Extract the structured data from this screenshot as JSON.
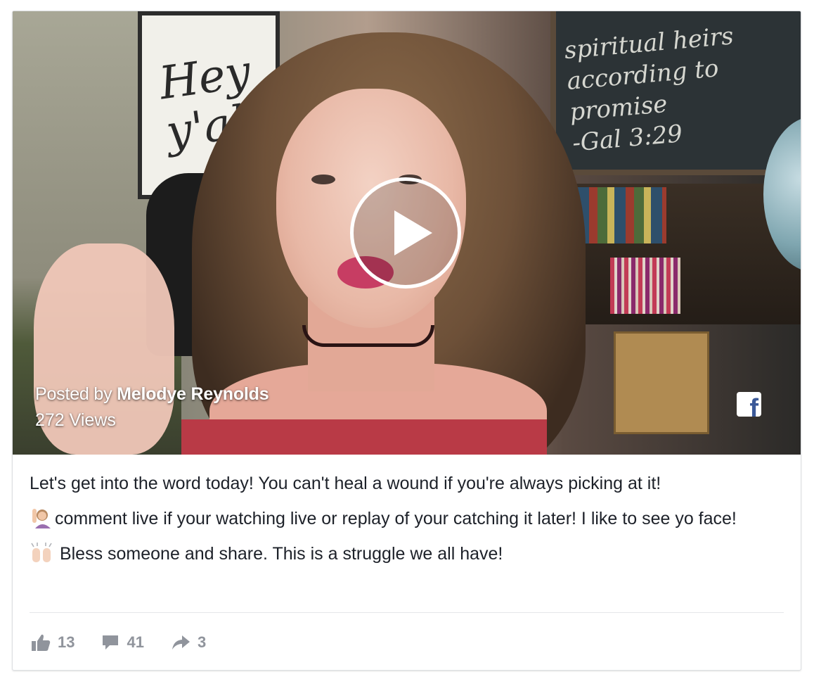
{
  "video": {
    "posted_prefix": "Posted by",
    "author": "Melodye Reynolds",
    "views": "272 Views",
    "brand_icon": "facebook-icon",
    "play_icon": "play-icon"
  },
  "caption": {
    "line1": "Let's get into the word today! You can't heal a wound if you're always picking at it!",
    "line2": "comment live if your watching live or replay of your catching it later! I like to see yo face!",
    "line2_emoji": "person-raising-hand-icon",
    "line3": " Bless someone and share. This is a struggle we all have!",
    "line3_emoji": "raising-hands-icon"
  },
  "stats": {
    "likes": "13",
    "comments": "41",
    "shares": "3"
  },
  "colors": {
    "text": "#1d2129",
    "meta": "#90949c",
    "facebook_blue": "#3b5998",
    "divider": "#e5e6e9"
  }
}
